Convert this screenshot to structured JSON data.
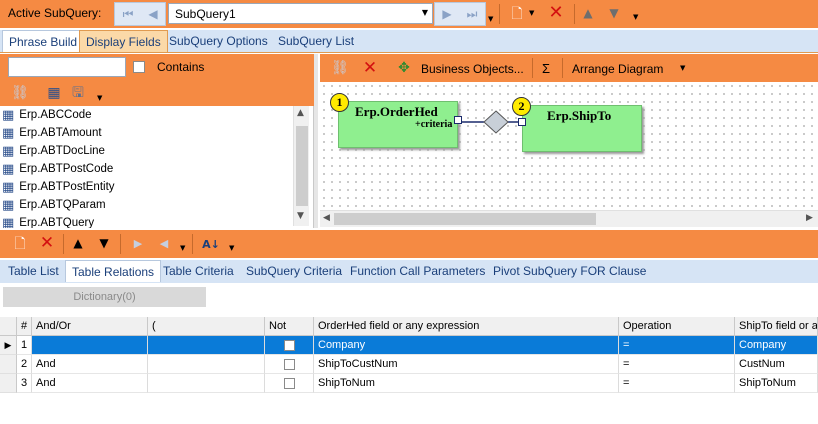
{
  "top_toolbar": {
    "active_subquery_label": "Active SubQuery:",
    "subquery_value": "SubQuery1"
  },
  "main_tabs": [
    {
      "label": "Phrase Build",
      "active": false
    },
    {
      "label": "Display Fields",
      "active": true
    },
    {
      "label": "SubQuery Options",
      "active": false
    },
    {
      "label": "SubQuery List",
      "active": false
    }
  ],
  "left_panel": {
    "search_value": "",
    "contains_label": "Contains",
    "tables": [
      "Erp.ABCCode",
      "Erp.ABTAmount",
      "Erp.ABTDocLine",
      "Erp.ABTPostCode",
      "Erp.ABTPostEntity",
      "Erp.ABTQParam",
      "Erp.ABTQuery"
    ]
  },
  "diagram_toolbar": {
    "business_objects_label": "Business Objects...",
    "sum_label": "Σ",
    "arrange_label": "Arrange Diagram"
  },
  "diagram": {
    "table1": {
      "num": "1",
      "name": "Erp.OrderHed",
      "criteria": "+criteria"
    },
    "table2": {
      "num": "2",
      "name": "Erp.ShipTo"
    }
  },
  "bottom_tabs": [
    {
      "label": "Table List",
      "active": false
    },
    {
      "label": "Table Relations",
      "active": true
    },
    {
      "label": "Table Criteria",
      "active": false
    },
    {
      "label": "SubQuery Criteria",
      "active": false
    },
    {
      "label": "Function Call Parameters",
      "active": false
    },
    {
      "label": "Pivot SubQuery FOR Clause",
      "active": false
    }
  ],
  "dictionary_label": "Dictionary(0)",
  "relations_grid": {
    "columns": [
      "#",
      "And/Or",
      "(",
      "Not",
      "OrderHed field or any expression",
      "Operation",
      "ShipTo field or a"
    ],
    "rows": [
      {
        "num": "1",
        "andor": "",
        "paren": "",
        "not": false,
        "field1": "Company",
        "op": "=",
        "field2": "Company",
        "selected": true
      },
      {
        "num": "2",
        "andor": "And",
        "paren": "",
        "not": false,
        "field1": "ShipToCustNum",
        "op": "=",
        "field2": "CustNum",
        "selected": false
      },
      {
        "num": "3",
        "andor": "And",
        "paren": "",
        "not": false,
        "field1": "ShipToNum",
        "op": "=",
        "field2": "ShipToNum",
        "selected": false
      }
    ]
  },
  "colors": {
    "toolbar_orange": "#f58a43",
    "tab_bar_blue": "#d6e4f5",
    "selected_row": "#0a7bd8",
    "table_node_green": "#8fef8f"
  }
}
